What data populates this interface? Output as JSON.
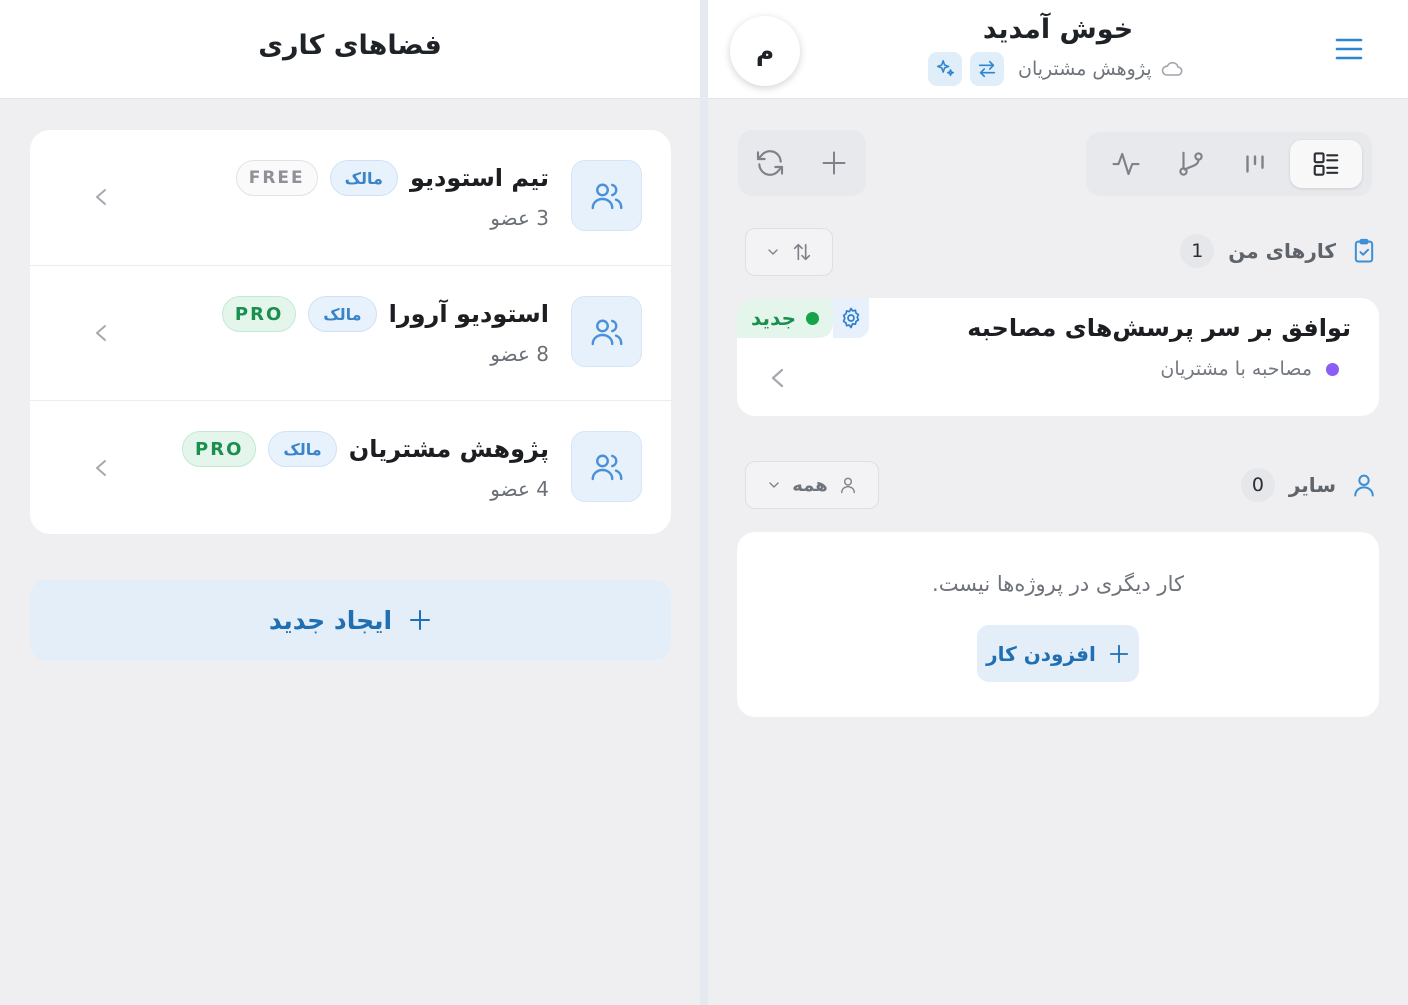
{
  "workspaces_panel": {
    "title": "فضاهای کاری",
    "items": [
      {
        "name": "تیم استودیو",
        "role": "مالک",
        "plan": "FREE",
        "members": "3 عضو"
      },
      {
        "name": "استودیو آرورا",
        "role": "مالک",
        "plan": "PRO",
        "members": "8 عضو"
      },
      {
        "name": "پژوهش مشتریان",
        "role": "مالک",
        "plan": "PRO",
        "members": "4 عضو"
      }
    ],
    "create_label": "ایجاد جدید"
  },
  "header": {
    "title": "خوش آمدید",
    "workspace": "پژوهش مشتریان",
    "avatar_initial": "م"
  },
  "my_tasks": {
    "label": "کارهای من",
    "count": "1",
    "task": {
      "title": "توافق بر سر پرسش‌های مصاحبه",
      "project": "مصاحبه با مشتریان",
      "status": "جدید"
    }
  },
  "others": {
    "label": "سایر",
    "count": "0",
    "filter_label": "همه",
    "empty_text": "کار دیگری در پروژه‌ها نیست.",
    "add_task_label": "افزودن کار"
  },
  "colors": {
    "accent": "#3a85c9",
    "pro_green": "#1b8f4e",
    "project_dot": "#8b5cf6"
  }
}
